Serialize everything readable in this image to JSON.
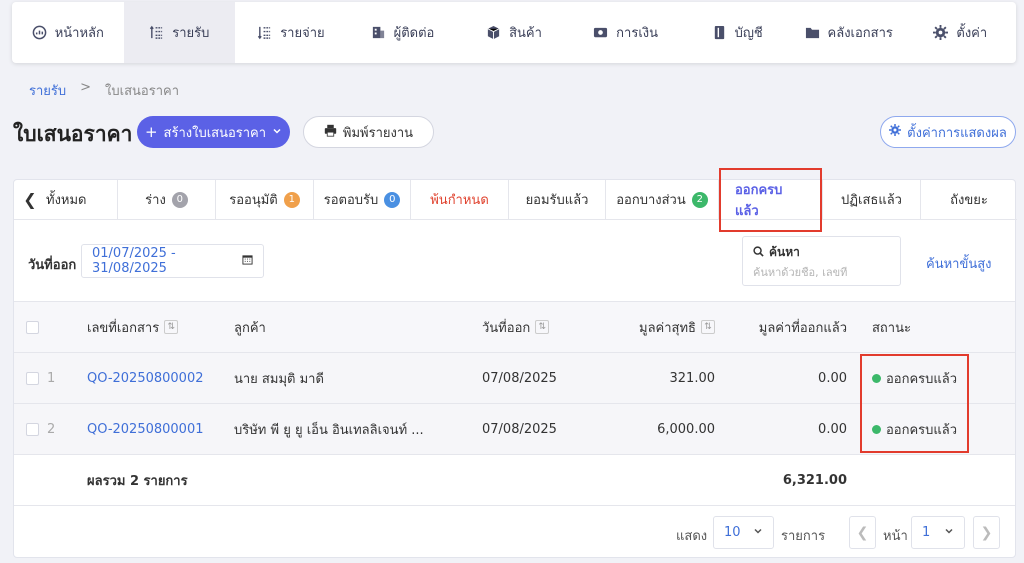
{
  "nav": [
    {
      "label": "หน้าหลัก",
      "icon": "dashboard-icon"
    },
    {
      "label": "รายรับ",
      "icon": "income-icon"
    },
    {
      "label": "รายจ่าย",
      "icon": "expense-icon"
    },
    {
      "label": "ผู้ติดต่อ",
      "icon": "contacts-icon"
    },
    {
      "label": "สินค้า",
      "icon": "box-icon"
    },
    {
      "label": "การเงิน",
      "icon": "money-icon"
    },
    {
      "label": "บัญชี",
      "icon": "ledger-icon"
    },
    {
      "label": "คลังเอกสาร",
      "icon": "folder-icon"
    },
    {
      "label": "ตั้งค่า",
      "icon": "gear-icon"
    }
  ],
  "breadcrumb": {
    "parent": "รายรับ",
    "sep": ">",
    "current": "ใบเสนอราคา"
  },
  "page_title": "ใบเสนอราคา",
  "buttons": {
    "create": "สร้างใบเสนอราคา",
    "print": "พิมพ์รายงาน",
    "display_settings": "ตั้งค่าการแสดงผล"
  },
  "tabs": [
    {
      "label": "ทั้งหมด"
    },
    {
      "label": "ร่าง",
      "badge": "0",
      "badge_color": "#a3a3ab"
    },
    {
      "label": "รออนุมัติ",
      "badge": "1",
      "badge_color": "#f0a04b"
    },
    {
      "label": "รอตอบรับ",
      "badge": "0",
      "badge_color": "#4a90e2"
    },
    {
      "label": "พ้นกำหนด"
    },
    {
      "label": "ยอมรับแล้ว"
    },
    {
      "label": "ออกบางส่วน",
      "badge": "2",
      "badge_color": "#3cb86a"
    },
    {
      "label": "ออกครบแล้ว"
    },
    {
      "label": "ปฏิเสธแล้ว"
    },
    {
      "label": "ถังขยะ"
    }
  ],
  "filter": {
    "date_label": "วันที่ออก",
    "date_range": "01/07/2025 - 31/08/2025",
    "search_title": "ค้นหา",
    "search_placeholder": "ค้นหาด้วยชื่อ, เลขที่",
    "advanced": "ค้นหาขั้นสูง"
  },
  "table": {
    "headers": {
      "doc_no": "เลขที่เอกสาร",
      "customer": "ลูกค้า",
      "date": "วันที่ออก",
      "net": "มูลค่าสุทธิ",
      "issued": "มูลค่าที่ออกแล้ว",
      "status": "สถานะ"
    },
    "rows": [
      {
        "idx": "1",
        "doc_no": "QO-20250800002",
        "customer": "นาย สมมุติ มาดี",
        "date": "07/08/2025",
        "net": "321.00",
        "issued": "0.00",
        "status": "ออกครบแล้ว"
      },
      {
        "idx": "2",
        "doc_no": "QO-20250800001",
        "customer": "บริษัท พี ยู ยู เอ็น อินเทลลิเจนท์ ...",
        "date": "07/08/2025",
        "net": "6,000.00",
        "issued": "0.00",
        "status": "ออกครบแล้ว"
      }
    ],
    "summary": {
      "label": "ผลรวม 2 รายการ",
      "issued_total": "6,321.00"
    }
  },
  "pager": {
    "show_label": "แสดง",
    "page_size": "10",
    "items_label": "รายการ",
    "page_label": "หน้า",
    "page": "1"
  }
}
